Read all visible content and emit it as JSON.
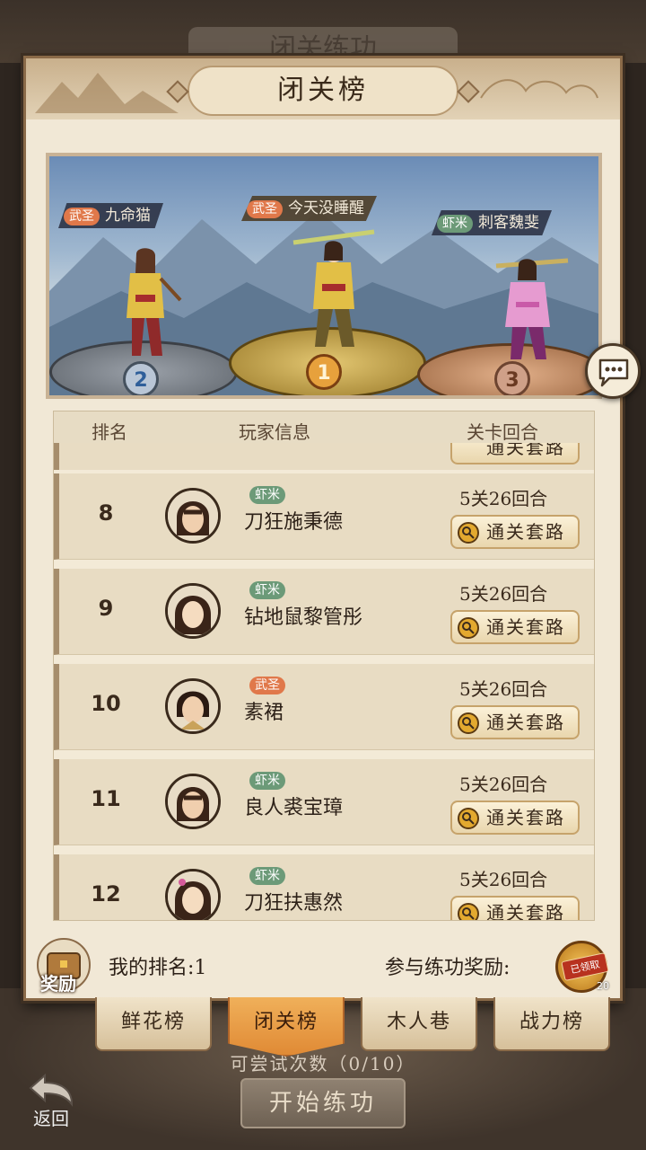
{
  "background": {
    "title": "闭关练功",
    "attempts_text": "可尝试次数（0/10）",
    "start_button": "开始练功",
    "back_label": "返回"
  },
  "panel": {
    "title": "闭关榜"
  },
  "podium": {
    "first": {
      "rank": "1",
      "tier": "武圣",
      "name": "今天没睡醒"
    },
    "second": {
      "rank": "2",
      "tier": "武圣",
      "name": "九命猫"
    },
    "third": {
      "rank": "3",
      "tier": "虾米",
      "name": "刺客魏斐"
    }
  },
  "list": {
    "headers": {
      "rank": "排名",
      "player": "玩家信息",
      "rounds": "关卡回合"
    },
    "partial_button": "通关套路",
    "rows": [
      {
        "rank": "8",
        "tier": "虾米",
        "name": "刀狂施秉德",
        "rounds": "5关26回合",
        "button": "通关套路"
      },
      {
        "rank": "9",
        "tier": "虾米",
        "name": "钻地鼠黎管彤",
        "rounds": "5关26回合",
        "button": "通关套路"
      },
      {
        "rank": "10",
        "tier": "武圣",
        "name": "素裙",
        "rounds": "5关26回合",
        "button": "通关套路"
      },
      {
        "rank": "11",
        "tier": "虾米",
        "name": "良人裘宝璋",
        "rounds": "5关26回合",
        "button": "通关套路"
      },
      {
        "rank": "12",
        "tier": "虾米",
        "name": "刀狂扶惠然",
        "rounds": "5关26回合",
        "button": "通关套路"
      }
    ]
  },
  "footer": {
    "reward_label": "奖励",
    "my_rank": "我的排名:1",
    "join_reward": "参与练功奖励:",
    "claimed": "已领取",
    "reward_count": "20"
  },
  "tabs": [
    {
      "label": "鲜花榜",
      "active": false
    },
    {
      "label": "闭关榜",
      "active": true
    },
    {
      "label": "木人巷",
      "active": false
    },
    {
      "label": "战力榜",
      "active": false
    }
  ],
  "colors": {
    "panel_bg": "#f1e8d6",
    "tier_wusheng": "#e0784a",
    "tier_xiami": "#6c9a78",
    "active_tab": "#e08a35"
  }
}
